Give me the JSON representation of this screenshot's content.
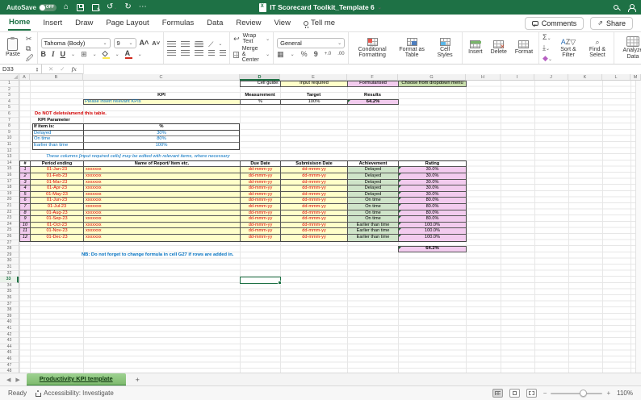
{
  "titlebar": {
    "autosave_label": "AutoSave",
    "autosave_state": "OFF",
    "title": "IT Scorecard Toolkit_Template 6"
  },
  "ribbon_tabs": {
    "home": "Home",
    "insert": "Insert",
    "draw": "Draw",
    "page_layout": "Page Layout",
    "formulas": "Formulas",
    "data": "Data",
    "review": "Review",
    "view": "View",
    "tell_me": "Tell me"
  },
  "top_right": {
    "comments": "Comments",
    "share": "Share"
  },
  "ribbon": {
    "paste": "Paste",
    "font_name": "Tahoma (Body)",
    "font_size": "9",
    "bold": "B",
    "italic": "I",
    "underline": "U",
    "wrap_text": "Wrap Text",
    "merge_center": "Merge & Center",
    "number_format": "General",
    "percent": "%",
    "comma": "9",
    "conditional_formatting": "Conditional Formatting",
    "format_as_table": "Format as Table",
    "cell_styles": "Cell Styles",
    "insert": "Insert",
    "delete": "Delete",
    "format": "Format",
    "sort_filter": "Sort & Filter",
    "find_select": "Find & Select",
    "analyze_data": "Analyze Data"
  },
  "formula_bar": {
    "name_box": "D33"
  },
  "grid": {
    "columns": [
      "A",
      "B",
      "C",
      "D",
      "E",
      "F",
      "G",
      "H",
      "I",
      "J",
      "K",
      "L",
      "M"
    ],
    "row_count": 49,
    "selection": {
      "cell": "D33",
      "column": "D",
      "row": 33
    }
  },
  "cells": {
    "cell_guide": "Cell guide:",
    "input_required": "Input required",
    "formularised": "Formularised",
    "choose_dropdown": "Choose from dropdown menu",
    "kpi_header": "KPI",
    "measurement_header": "Measurement",
    "target_header": "Target",
    "results_header": "Results",
    "kpi_input": "Please insert relevant KPIs",
    "measurement_value": "%",
    "target_value": "100%",
    "results_value": "64.2%",
    "do_not_delete": "Do NOT delete/amend this table.",
    "kpi_parameter": "KPI Parameter",
    "param_header_item": "If item is:",
    "param_header_pct": "%",
    "note_columns": "These columns [input required cells] may be edited with relevant items, where necessary",
    "nb_note": "NB: Do not forget to change formula in cell G27 if rows are added in.",
    "total_rating": "64.2%"
  },
  "kpi_parameters": [
    {
      "item": "Delayed",
      "pct": "30%"
    },
    {
      "item": "On time",
      "pct": "80%"
    },
    {
      "item": "Earlier than time",
      "pct": "100%"
    }
  ],
  "main_table": {
    "headers": [
      "#",
      "Period ending",
      "Name of Report/ Item etc.",
      "Due Date",
      "Submisison Date",
      "Achievement",
      "Rating"
    ],
    "rows": [
      {
        "num": "1",
        "period": "01-Jan-23",
        "name": "xxxxxxx",
        "due": "dd-mmm-yy",
        "sub": "dd-mmm-yy",
        "ach": "Delayed",
        "rating": "30.0%"
      },
      {
        "num": "2",
        "period": "01-Feb-23",
        "name": "xxxxxxx",
        "due": "dd-mmm-yy",
        "sub": "dd-mmm-yy",
        "ach": "Delayed",
        "rating": "30.0%"
      },
      {
        "num": "3",
        "period": "01-Mar-23",
        "name": "xxxxxxx",
        "due": "dd-mmm-yy",
        "sub": "dd-mmm-yy",
        "ach": "Delayed",
        "rating": "30.0%"
      },
      {
        "num": "4",
        "period": "01-Apr-23",
        "name": "xxxxxxx",
        "due": "dd-mmm-yy",
        "sub": "dd-mmm-yy",
        "ach": "Delayed",
        "rating": "30.0%"
      },
      {
        "num": "5",
        "period": "01-May-23",
        "name": "xxxxxxx",
        "due": "dd-mmm-yy",
        "sub": "dd-mmm-yy",
        "ach": "Delayed",
        "rating": "30.0%"
      },
      {
        "num": "6",
        "period": "01-Jun-23",
        "name": "xxxxxxx",
        "due": "dd-mmm-yy",
        "sub": "dd-mmm-yy",
        "ach": "On time",
        "rating": "80.0%"
      },
      {
        "num": "7",
        "period": "01-Jul-23",
        "name": "xxxxxxx",
        "due": "dd-mmm-yy",
        "sub": "dd-mmm-yy",
        "ach": "On time",
        "rating": "80.0%"
      },
      {
        "num": "8",
        "period": "01-Aug-23",
        "name": "xxxxxxx",
        "due": "dd-mmm-yy",
        "sub": "dd-mmm-yy",
        "ach": "On time",
        "rating": "80.0%"
      },
      {
        "num": "9",
        "period": "01-Sep-23",
        "name": "xxxxxxx",
        "due": "dd-mmm-yy",
        "sub": "dd-mmm-yy",
        "ach": "On time",
        "rating": "80.0%"
      },
      {
        "num": "10",
        "period": "01-Oct-23",
        "name": "xxxxxxx",
        "due": "dd-mmm-yy",
        "sub": "dd-mmm-yy",
        "ach": "Earlier than time",
        "rating": "100.0%"
      },
      {
        "num": "11",
        "period": "01-Nov-23",
        "name": "xxxxxxx",
        "due": "dd-mmm-yy",
        "sub": "dd-mmm-yy",
        "ach": "Earlier than time",
        "rating": "100.0%"
      },
      {
        "num": "12",
        "period": "01-Dec-23",
        "name": "xxxxxxx",
        "due": "dd-mmm-yy",
        "sub": "dd-mmm-yy",
        "ach": "Earlier than time",
        "rating": "100.0%"
      }
    ]
  },
  "sheet_tabs": {
    "active": "Productivity KPI template",
    "add": "+"
  },
  "status_bar": {
    "ready": "Ready",
    "accessibility": "Accessibility: Investigate",
    "zoom": "110%"
  },
  "colors": {
    "excel_green": "#1e7145",
    "input_yellow": "#ffffc9",
    "formula_pink": "#f2cbee",
    "dropdown_green": "#c9dfac",
    "achievement_green": "#cfe4c9"
  }
}
